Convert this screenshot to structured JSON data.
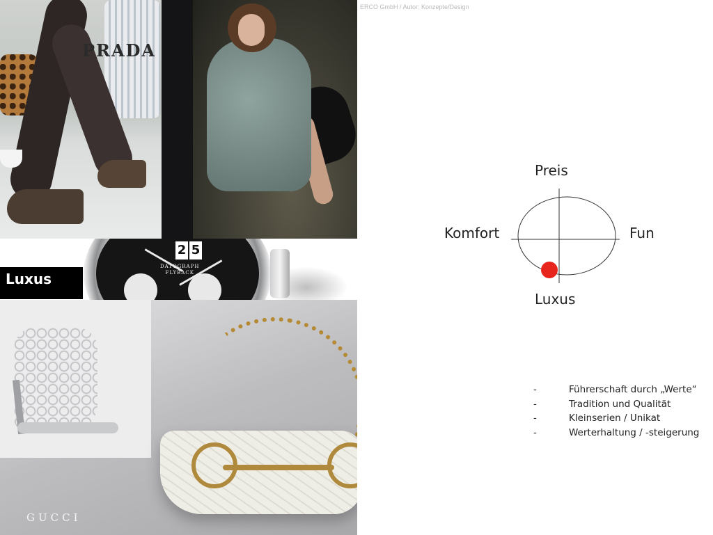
{
  "header": {
    "copyright": "ERCO GmbH / Autor: Konzepte/Design"
  },
  "collage": {
    "prada_logo": "PRADA",
    "watch_date": [
      "2",
      "5"
    ],
    "watch_brand": "DATOGRAPH\nFLYBACK",
    "section_label": "Luxus",
    "gucci_logo": "GUCCI"
  },
  "diagram": {
    "top": "Preis",
    "left": "Komfort",
    "right": "Fun",
    "bottom": "Luxus",
    "marker_color": "#e8251d",
    "marker_position": "bottom-left"
  },
  "bullets": {
    "dash": "-",
    "items": [
      "Führerschaft durch „Werte“",
      "Tradition und Qualität",
      "Kleinserien / Unikat",
      "Werterhaltung / -steigerung"
    ]
  }
}
